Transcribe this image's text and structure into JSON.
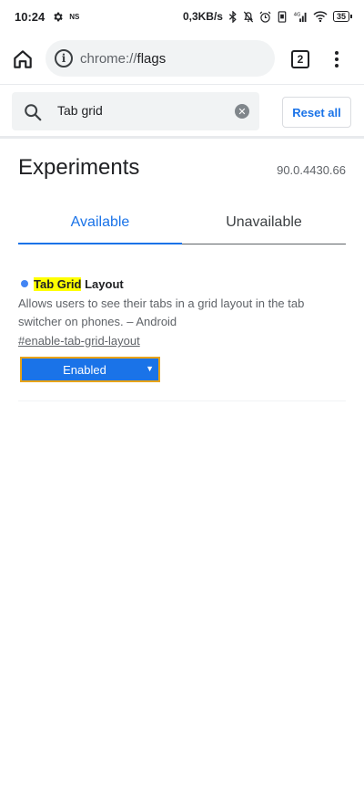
{
  "status_bar": {
    "time": "10:24",
    "ns_label": "NS",
    "network_speed": "0,3KB/s",
    "signal_label": "4G",
    "battery": "35"
  },
  "toolbar": {
    "url_scheme": "chrome://",
    "url_host": "flags",
    "tab_count": "2"
  },
  "search": {
    "value": "Tab grid",
    "reset_label": "Reset all"
  },
  "main": {
    "title": "Experiments",
    "version": "90.0.4430.66",
    "tabs": [
      {
        "label": "Available",
        "active": true
      },
      {
        "label": "Unavailable",
        "active": false
      }
    ]
  },
  "flag": {
    "name_highlight": "Tab Grid",
    "name_rest": " Layout",
    "description": "Allows users to see their tabs in a grid layout in the tab switcher on phones. – Android",
    "link": "#enable-tab-grid-layout",
    "selected_option": "Enabled"
  },
  "colors": {
    "accent": "#1a73e8",
    "highlight": "#ffff00",
    "dot": "#4285f4"
  },
  "icons": [
    "gear-icon",
    "bluetooth-icon",
    "bell-off-icon",
    "alarm-icon",
    "vibrate-icon",
    "signal-icon",
    "wifi-icon",
    "battery-icon",
    "home-icon",
    "info-icon",
    "search-icon",
    "clear-icon",
    "menu-icon"
  ]
}
